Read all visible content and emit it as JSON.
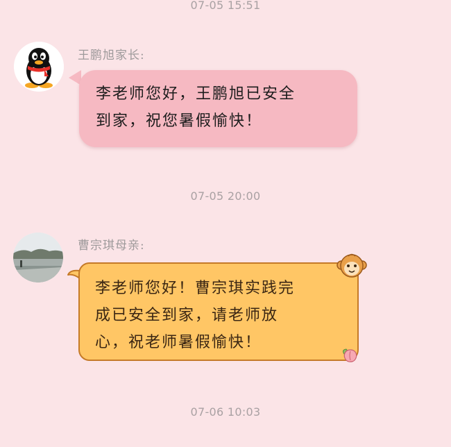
{
  "timestamps": {
    "t1": "07-05 15:51",
    "t2": "07-05 20:00",
    "t3": "07-06 10:03"
  },
  "messages": [
    {
      "sender": "王鹏旭家长:",
      "avatar_icon": "qq-penguin-icon",
      "lines": [
        "李老师您好，王鹏旭已安全",
        "到家，祝您暑假愉快！"
      ],
      "bubble_color": "#f6b9c2"
    },
    {
      "sender": "曹宗琪母亲:",
      "avatar_icon": "landscape-photo-avatar",
      "lines": [
        "李老师您好！曹宗琪实践完",
        "成已安全到家，请老师放",
        "心，祝老师暑假愉快！"
      ],
      "bubble_color": "#ffc665"
    }
  ],
  "colors": {
    "background": "#fbe4e7",
    "timestamp": "#a9a1a3",
    "sender": "#9e9a9b"
  }
}
